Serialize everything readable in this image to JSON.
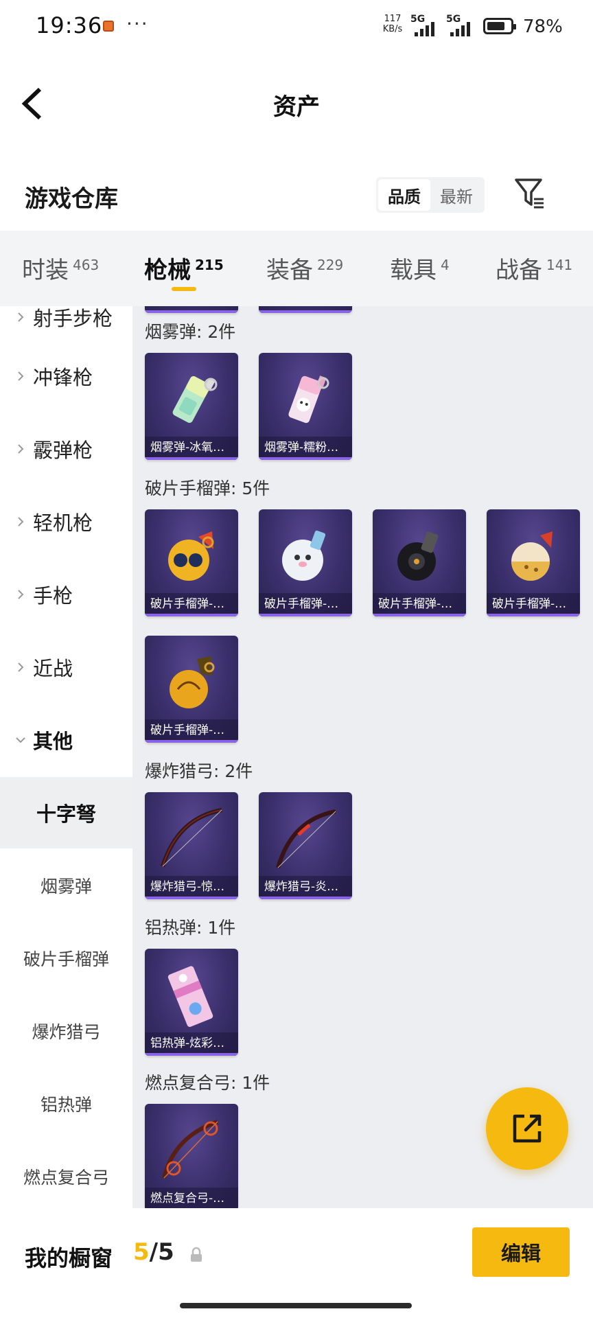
{
  "status_bar": {
    "time": "19:36",
    "speed_value": "117",
    "speed_unit": "KB/s",
    "sim1": "5G",
    "sim2": "5G",
    "battery": "78%",
    "battery_level": 0.78
  },
  "header": {
    "title": "资产"
  },
  "warehouse": {
    "title": "游戏仓库",
    "sort_options": [
      "品质",
      "最新"
    ],
    "sort_selected": "品质"
  },
  "category_tabs": [
    {
      "label": "时装",
      "count": "463"
    },
    {
      "label": "枪械",
      "count": "215",
      "active": true
    },
    {
      "label": "装备",
      "count": "229"
    },
    {
      "label": "载具",
      "count": "4"
    },
    {
      "label": "战备",
      "count": "141"
    }
  ],
  "sidebar": {
    "partial_item": "射手步枪",
    "groups": [
      "冲锋枪",
      "霰弹枪",
      "轻机枪",
      "手枪",
      "近战",
      "其他"
    ],
    "sub_items": [
      "十字弩",
      "烟雾弹",
      "破片手榴弹",
      "爆炸猎弓",
      "铝热弹",
      "燃点复合弓"
    ],
    "active_sub": "十字弩"
  },
  "sections": [
    {
      "title": "烟雾弹: 2件",
      "items": [
        "烟雾弹-冰氧…",
        "烟雾弹-糯粉…"
      ]
    },
    {
      "title": "破片手榴弹: 5件",
      "items": [
        "破片手榴弹-…",
        "破片手榴弹-…",
        "破片手榴弹-…",
        "破片手榴弹-…",
        "破片手榴弹-…"
      ]
    },
    {
      "title": "爆炸猎弓: 2件",
      "items": [
        "爆炸猎弓-惊…",
        "爆炸猎弓-炎…"
      ]
    },
    {
      "title": "铝热弹: 1件",
      "items": [
        "铝热弹-炫彩…"
      ]
    },
    {
      "title": "燃点复合弓: 1件",
      "items": [
        "燃点复合弓-…"
      ]
    }
  ],
  "bottom_bar": {
    "window_label": "我的橱窗",
    "window_current": "5",
    "window_sep": "/",
    "window_max": "5",
    "edit_label": "编辑"
  },
  "colors": {
    "accent": "#f6b90f",
    "card_bg": "#3a2f6b",
    "card_edge": "#8a63e6"
  },
  "icons": [
    "back-arrow-icon",
    "filter-icon",
    "chevron-right-icon",
    "chevron-down-icon",
    "share-icon",
    "lock-icon"
  ]
}
